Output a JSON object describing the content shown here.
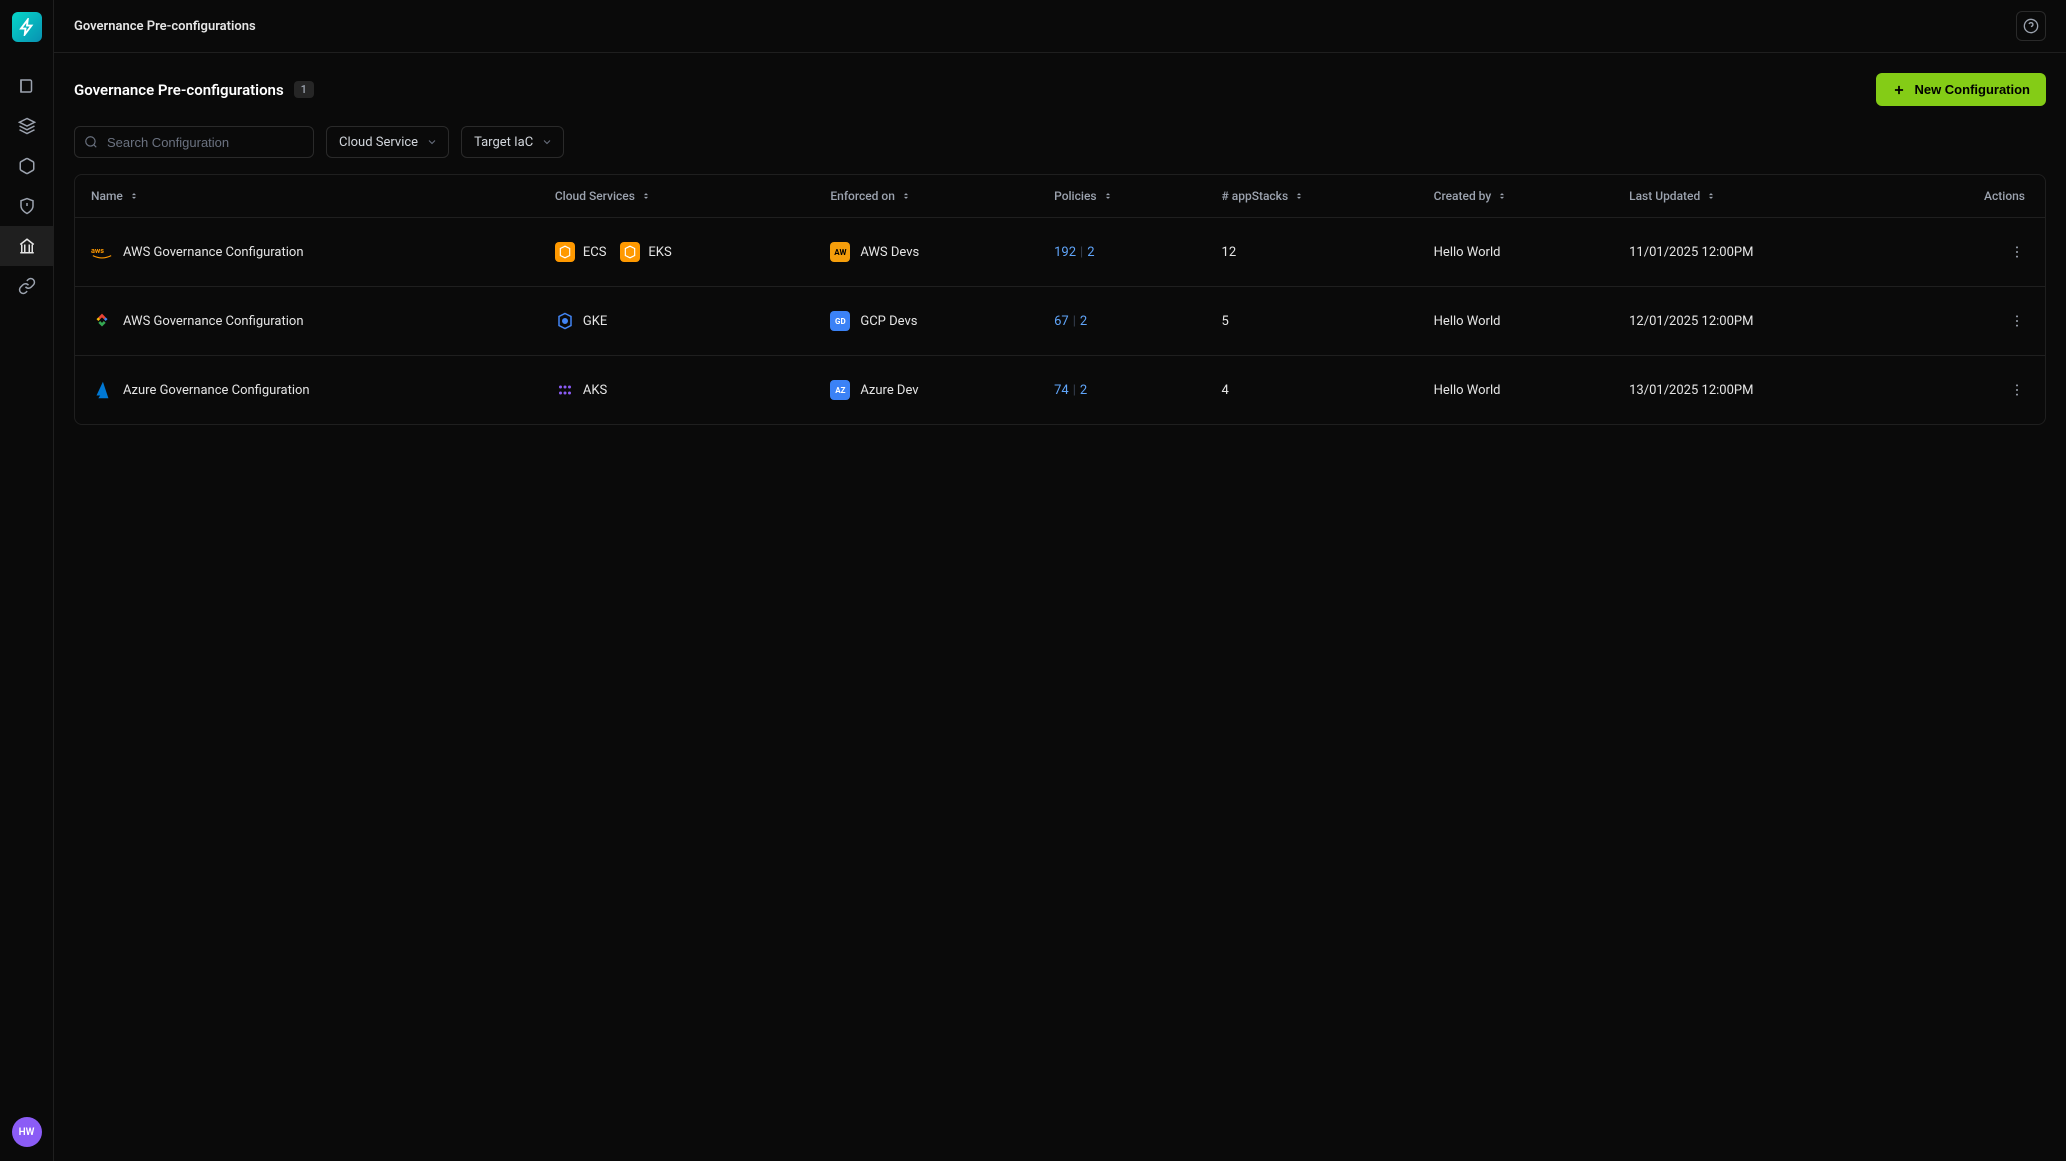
{
  "sidebar": {
    "avatar_initials": "HW"
  },
  "topbar": {
    "breadcrumb": "Governance Pre-configurations"
  },
  "page": {
    "title": "Governance Pre-configurations",
    "count": "1",
    "new_button_label": "New Configuration"
  },
  "filters": {
    "search_placeholder": "Search Configuration",
    "cloud_service_label": "Cloud Service",
    "target_iac_label": "Target IaC"
  },
  "columns": {
    "name": "Name",
    "cloud_services": "Cloud Services",
    "enforced_on": "Enforced on",
    "policies": "Policies",
    "app_stacks": "# appStacks",
    "created_by": "Created by",
    "last_updated": "Last Updated",
    "actions": "Actions"
  },
  "rows": [
    {
      "provider": "aws",
      "name": "AWS Governance Configuration",
      "services": [
        {
          "icon": "ecs",
          "label": "ECS"
        },
        {
          "icon": "eks",
          "label": "EKS"
        }
      ],
      "enforced": {
        "badge": "AW",
        "badge_class": "team-aw",
        "label": "AWS Devs"
      },
      "policies_a": "192",
      "policies_b": "2",
      "app_stacks": "12",
      "created_by": "Hello World",
      "last_updated": "11/01/2025 12:00PM"
    },
    {
      "provider": "gcp",
      "name": "AWS Governance Configuration",
      "services": [
        {
          "icon": "gke",
          "label": "GKE"
        }
      ],
      "enforced": {
        "badge": "GD",
        "badge_class": "team-gd",
        "label": "GCP Devs"
      },
      "policies_a": "67",
      "policies_b": "2",
      "app_stacks": "5",
      "created_by": "Hello World",
      "last_updated": "12/01/2025 12:00PM"
    },
    {
      "provider": "azure",
      "name": "Azure Governance Configuration",
      "services": [
        {
          "icon": "aks",
          "label": "AKS"
        }
      ],
      "enforced": {
        "badge": "AZ",
        "badge_class": "team-az",
        "label": "Azure Dev"
      },
      "policies_a": "74",
      "policies_b": "2",
      "app_stacks": "4",
      "created_by": "Hello World",
      "last_updated": "13/01/2025 12:00PM"
    }
  ]
}
